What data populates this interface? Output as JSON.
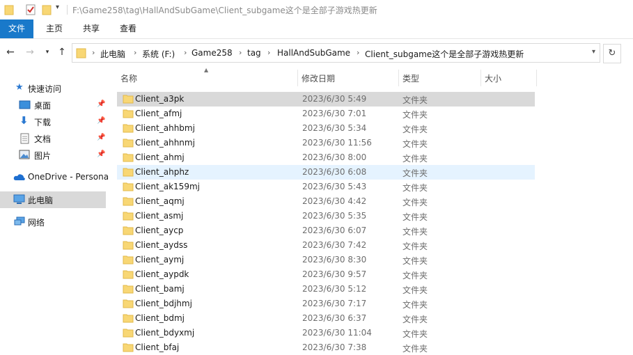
{
  "window": {
    "title": "F:\\Game258\\tag\\HallAndSubGame\\Client_subgame这个是全部子游戏热更新"
  },
  "quick_access_toolbar": [
    "folder-icon",
    "properties-check-icon",
    "new-folder-icon",
    "dropdown-arrow-icon"
  ],
  "ribbon": {
    "tabs": [
      "文件",
      "主页",
      "共享",
      "查看"
    ],
    "active_tab": "文件",
    "accent": "#1979ca"
  },
  "address": {
    "crumbs": [
      "此电脑",
      "系统 (F:)",
      "Game258",
      "tag",
      "HallAndSubGame",
      "Client_subgame这个是全部子游戏热更新"
    ]
  },
  "sidebar": {
    "items": [
      {
        "label": "快速访问",
        "icon": "star-icon",
        "pinned": false
      },
      {
        "label": "桌面",
        "icon": "desktop-icon",
        "pinned": true
      },
      {
        "label": "下载",
        "icon": "download-arrow-icon",
        "pinned": true
      },
      {
        "label": "文档",
        "icon": "document-icon",
        "pinned": true
      },
      {
        "label": "图片",
        "icon": "picture-icon",
        "pinned": true
      },
      {
        "label": "OneDrive - Persona",
        "icon": "cloud-icon",
        "pinned": false
      },
      {
        "label": "此电脑",
        "icon": "computer-icon",
        "pinned": false
      },
      {
        "label": "网络",
        "icon": "network-icon",
        "pinned": false
      }
    ],
    "selected": "此电脑"
  },
  "columns": [
    "名称",
    "修改日期",
    "类型",
    "大小"
  ],
  "files": [
    {
      "name": "Client_a3pk",
      "date": "2023/6/30 5:49",
      "type": "文件夹"
    },
    {
      "name": "Client_afmj",
      "date": "2023/6/30 7:01",
      "type": "文件夹"
    },
    {
      "name": "Client_ahhbmj",
      "date": "2023/6/30 5:34",
      "type": "文件夹"
    },
    {
      "name": "Client_ahhnmj",
      "date": "2023/6/30 11:56",
      "type": "文件夹"
    },
    {
      "name": "Client_ahmj",
      "date": "2023/6/30 8:00",
      "type": "文件夹"
    },
    {
      "name": "Client_ahphz",
      "date": "2023/6/30 6:08",
      "type": "文件夹"
    },
    {
      "name": "Client_ak159mj",
      "date": "2023/6/30 5:43",
      "type": "文件夹"
    },
    {
      "name": "Client_aqmj",
      "date": "2023/6/30 4:42",
      "type": "文件夹"
    },
    {
      "name": "Client_asmj",
      "date": "2023/6/30 5:35",
      "type": "文件夹"
    },
    {
      "name": "Client_aycp",
      "date": "2023/6/30 6:07",
      "type": "文件夹"
    },
    {
      "name": "Client_aydss",
      "date": "2023/6/30 7:42",
      "type": "文件夹"
    },
    {
      "name": "Client_aymj",
      "date": "2023/6/30 8:30",
      "type": "文件夹"
    },
    {
      "name": "Client_aypdk",
      "date": "2023/6/30 9:57",
      "type": "文件夹"
    },
    {
      "name": "Client_bamj",
      "date": "2023/6/30 5:12",
      "type": "文件夹"
    },
    {
      "name": "Client_bdjhmj",
      "date": "2023/6/30 7:17",
      "type": "文件夹"
    },
    {
      "name": "Client_bdmj",
      "date": "2023/6/30 6:37",
      "type": "文件夹"
    },
    {
      "name": "Client_bdyxmj",
      "date": "2023/6/30 11:04",
      "type": "文件夹"
    },
    {
      "name": "Client_bfaj",
      "date": "2023/6/30 7:38",
      "type": "文件夹"
    }
  ],
  "selected_file": "Client_a3pk",
  "hovered_file": "Client_ahphz",
  "colors": {
    "folder": "#f8d775",
    "folder_dark": "#e2b84a",
    "selection": "#d9d9d9",
    "hover": "#e5f3ff"
  }
}
